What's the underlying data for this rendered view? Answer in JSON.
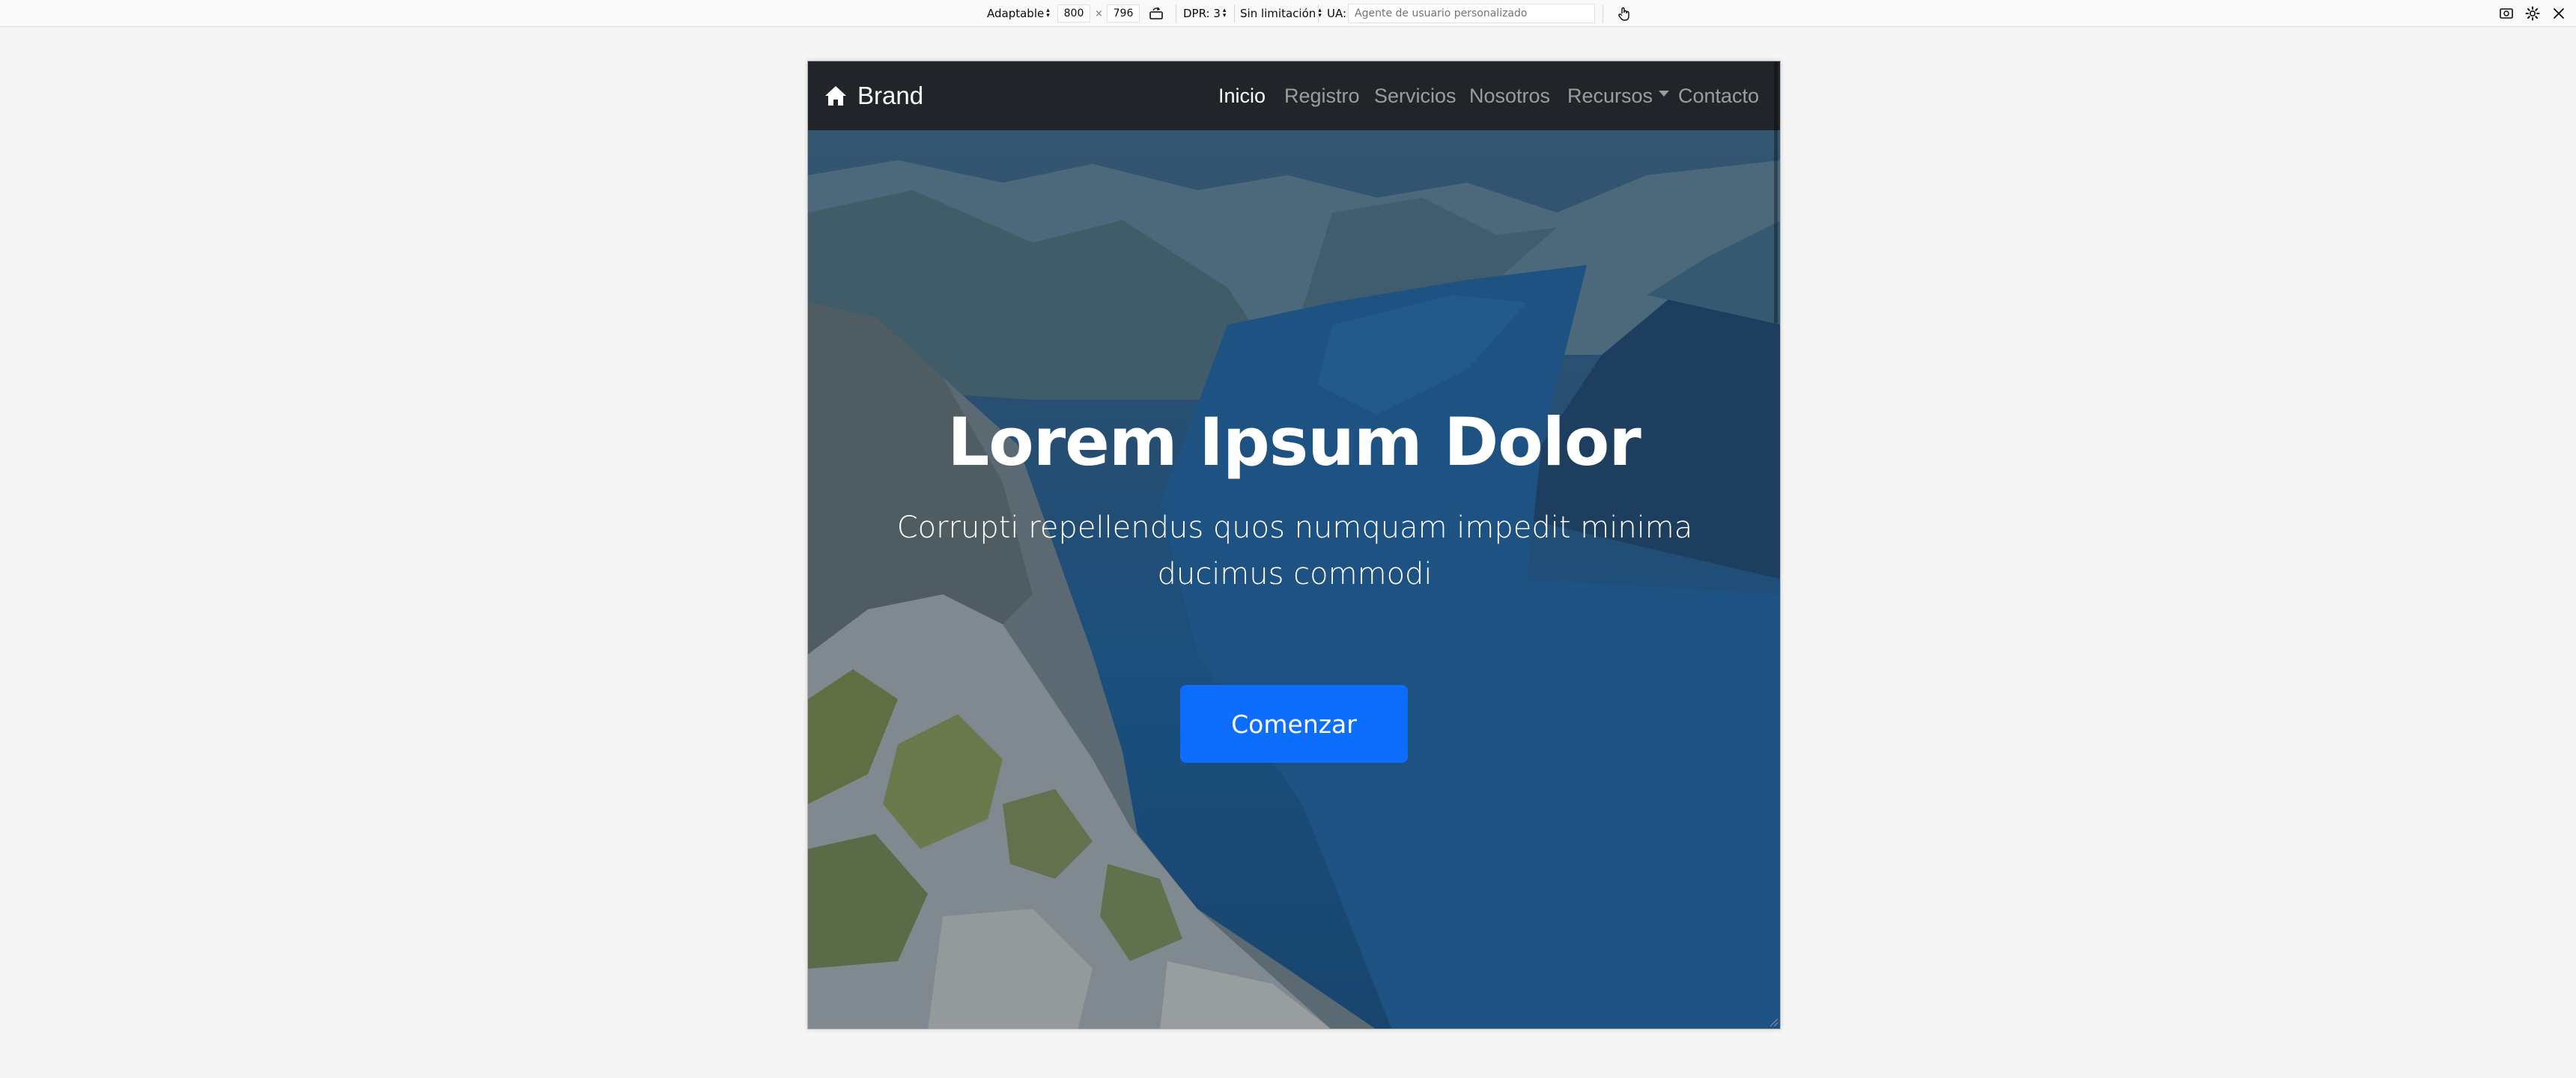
{
  "toolbar": {
    "device_selector": "Adaptable",
    "width_value": "800",
    "times_sign": "×",
    "height_value": "796",
    "dpr_label": "DPR: 3",
    "throttling_label": "Sin limitación",
    "ua_label": "UA:",
    "ua_placeholder": "Agente de usuario personalizado"
  },
  "page": {
    "brand": "Brand",
    "nav": [
      "Inicio",
      "Registro",
      "Servicios",
      "Nosotros",
      "Recursos",
      "Contacto"
    ],
    "hero_title": "Lorem Ipsum Dolor",
    "hero_subtitle": "Corrupti repellendus quos numquam impedit minima ducimus commodi",
    "cta_label": "Comenzar"
  },
  "colors": {
    "navbar": "#212529",
    "primary_button": "#0d6efd",
    "toolbar_bg": "#f9f9fa",
    "canvas_bg": "#f5f5f5"
  },
  "icons": [
    "rotate-icon",
    "touch-simulation-icon",
    "screenshot-icon",
    "settings-icon",
    "close-icon",
    "home-icon"
  ]
}
